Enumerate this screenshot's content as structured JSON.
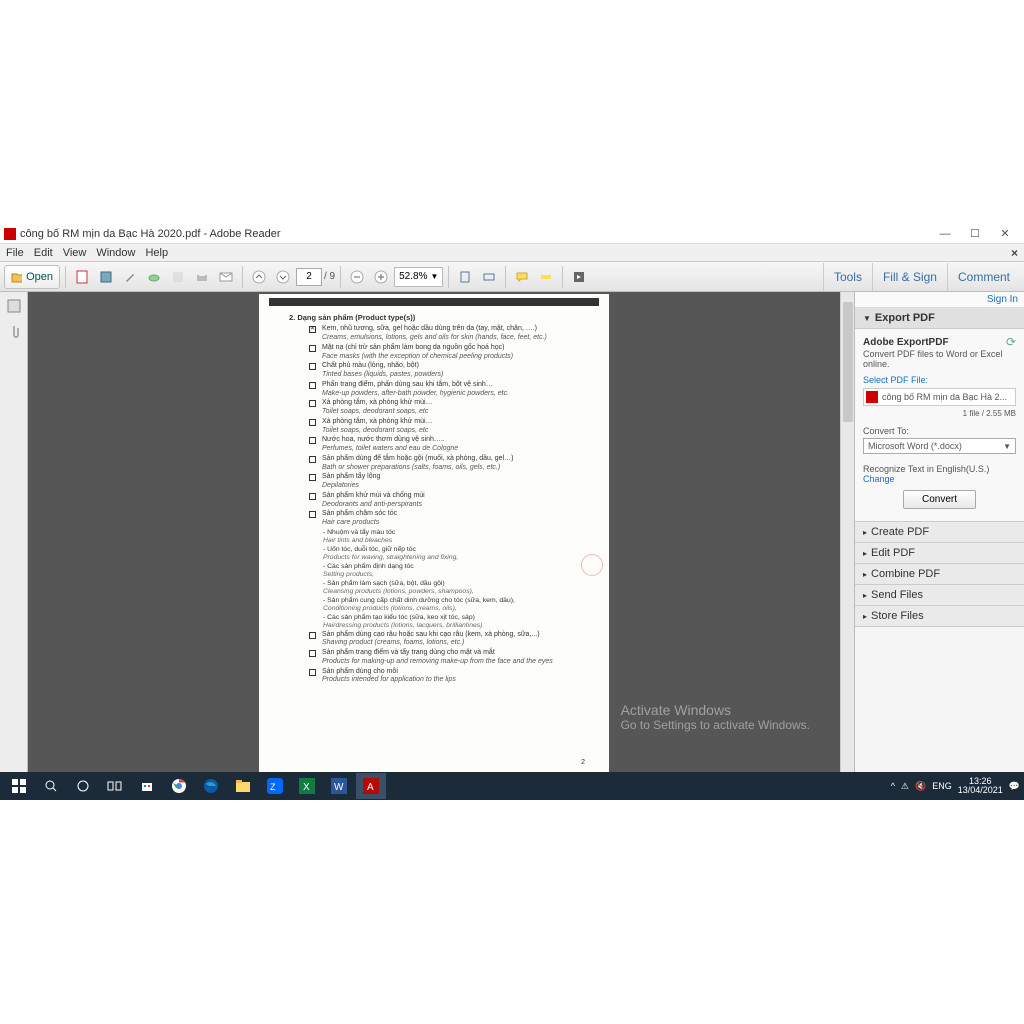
{
  "title": "công bố RM mịn da Bạc Hà 2020.pdf - Adobe Reader",
  "menu": {
    "file": "File",
    "edit": "Edit",
    "view": "View",
    "window": "Window",
    "help": "Help"
  },
  "toolbar": {
    "open": "Open",
    "page": "2",
    "pages": "/ 9",
    "zoom": "52.8%"
  },
  "rtabs": {
    "tools": "Tools",
    "fill": "Fill & Sign",
    "comment": "Comment"
  },
  "signin": "Sign In",
  "export": {
    "title": "Export PDF",
    "hd": "Adobe ExportPDF",
    "sub": "Convert PDF files to Word or Excel online.",
    "select": "Select PDF File:",
    "file": "công bố RM mịn da Bạc Hà 2...",
    "size": "1 file / 2.55 MB",
    "convto": "Convert To:",
    "format": "Microsoft Word (*.docx)",
    "ocr": "Recognize Text in English(U.S.)",
    "change": "Change",
    "btn": "Convert"
  },
  "accords": [
    "Create PDF",
    "Edit PDF",
    "Combine PDF",
    "Send Files",
    "Store Files"
  ],
  "watermark": {
    "t1": "Activate Windows",
    "t2": "Go to Settings to activate Windows."
  },
  "sys": {
    "lang": "ENG",
    "time": "13:26",
    "date": "13/04/2021"
  },
  "doc": {
    "heading": "2. Dạng sản phẩm (Product type(s))",
    "items": [
      {
        "c": true,
        "vn": "Kem, nhũ tương, sữa, gel hoặc dầu dùng trên da (tay, mặt, chân, ….)",
        "en": "Creams, emulsions, lotions, gels and oils for skin (hands, face, feet, etc.)"
      },
      {
        "c": false,
        "vn": "Mặt nạ (chỉ trừ sản phẩm làm bong da nguồn gốc hoá học)",
        "en": "Face masks (with the exception of chemical peeling products)"
      },
      {
        "c": false,
        "vn": "Chất phủ màu (lỏng, nhão, bột)",
        "en": "Tinted bases (liquids, pastes, powders)"
      },
      {
        "c": false,
        "vn": "Phấn trang điểm, phấn dùng sau khi tắm, bột vệ sinh…",
        "en": "Make-up powders, after-bath powder, hygienic powders, etc."
      },
      {
        "c": false,
        "vn": "Xà phòng tắm, xà phòng khử mùi…",
        "en": "Toilet soaps, deodorant soaps, etc"
      },
      {
        "c": false,
        "vn": "Xà phòng tắm, xà phòng khử mùi…",
        "en": "Toilet soaps, deodorant soaps, etc"
      },
      {
        "c": false,
        "vn": "Nước hoa, nước thơm dùng vệ sinh…..",
        "en": "Perfumes, toilet waters and eau de Cologne"
      },
      {
        "c": false,
        "vn": "Sản phẩm dùng để tắm hoặc gội (muối, xà phòng, dầu, gel…)",
        "en": "Bath or shower preparations (salts, foams, oils, gels, etc.)"
      },
      {
        "c": false,
        "vn": "Sản phẩm tẩy lông",
        "en": "Depilatories"
      },
      {
        "c": false,
        "vn": "Sản phẩm khử mùi và chống mùi",
        "en": "Deodorants and anti-perspirants"
      },
      {
        "c": false,
        "vn": "Sản phẩm chăm sóc tóc",
        "en": "Hair care products"
      }
    ],
    "subs": [
      "- Nhuộm và tẩy màu tóc",
      "Hair tints and bleaches",
      "- Uốn tóc, duỗi tóc, giữ nếp tóc",
      "Products for waving, straightening and fixing,",
      "- Các sản phẩm định dạng tóc",
      "Setting products,",
      "- Sản phẩm làm sạch (sữa, bột, dầu gội)",
      "Cleansing products (lotions, powders, shampoos),",
      "- Sản phẩm cung cấp chất dinh dưỡng cho tóc (sữa, kem, dầu),",
      "Conditioning products (lotions, creams, oils),",
      "- Các sản phẩm tạo kiểu tóc (sữa, keo xịt tóc, sáp)",
      "Hairdressing products (lotions, lacquers, brilliantines)"
    ],
    "items2": [
      {
        "c": false,
        "vn": "Sản phẩm dùng cạo râu hoặc sau khi cạo râu (kem, xà phòng, sữa,...)",
        "en": "Shaving product (creams, foams, lotions, etc.)"
      },
      {
        "c": false,
        "vn": "Sản phẩm trang điểm và tẩy trang dùng cho mặt và mắt",
        "en": "Products for making-up and removing make-up from the face and the eyes"
      },
      {
        "c": false,
        "vn": "Sản phẩm dùng cho môi",
        "en": "Products intended for application to the lips"
      }
    ],
    "pgno": "2"
  }
}
